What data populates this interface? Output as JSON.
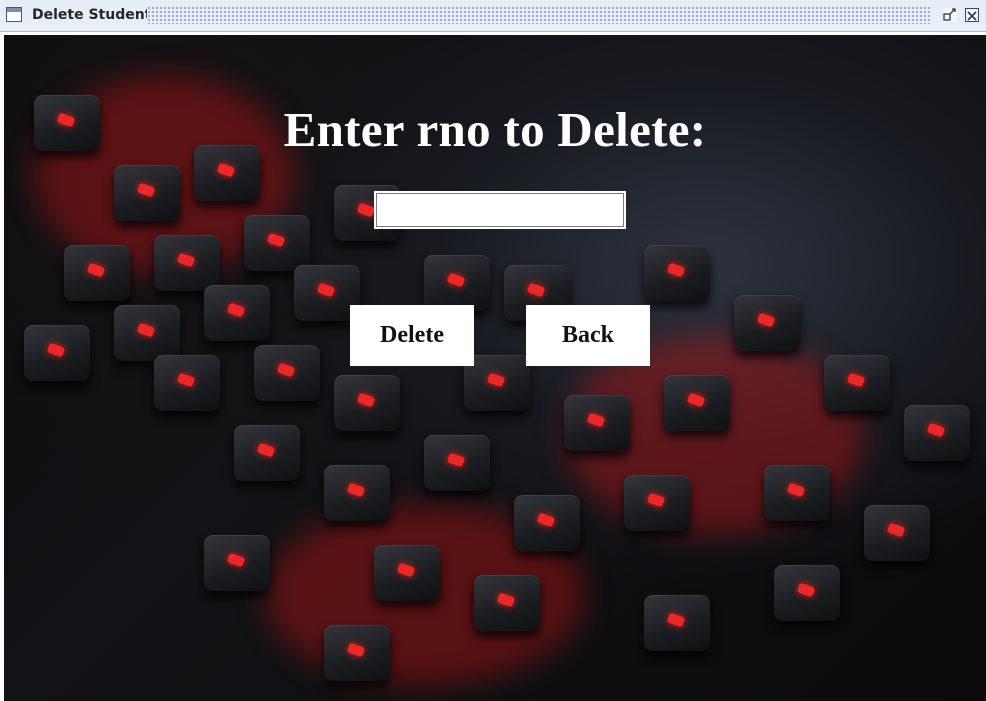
{
  "window": {
    "title": "Delete Student",
    "icon": "window-icon",
    "controls": [
      "restore-icon",
      "close-icon"
    ]
  },
  "background": {
    "description_icon": "keyboard-photo"
  },
  "form": {
    "heading": "Enter rno to Delete:",
    "rno_value": "",
    "delete_label": "Delete",
    "back_label": "Back"
  }
}
